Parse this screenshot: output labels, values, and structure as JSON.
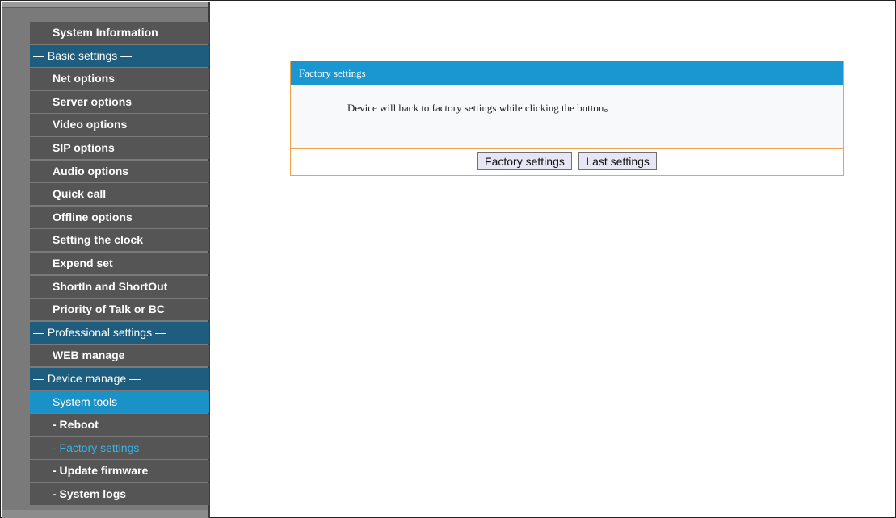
{
  "sidebar": {
    "items": [
      {
        "label": "System Information",
        "kind": "item"
      },
      {
        "label": "— Basic settings —",
        "kind": "group"
      },
      {
        "label": "Net options",
        "kind": "item"
      },
      {
        "label": "Server options",
        "kind": "item"
      },
      {
        "label": "Video options",
        "kind": "item"
      },
      {
        "label": "SIP options",
        "kind": "item"
      },
      {
        "label": "Audio options",
        "kind": "item"
      },
      {
        "label": "Quick call",
        "kind": "item"
      },
      {
        "label": "Offline options",
        "kind": "item"
      },
      {
        "label": "Setting the clock",
        "kind": "item"
      },
      {
        "label": "Expend set",
        "kind": "item"
      },
      {
        "label": "ShortIn and ShortOut",
        "kind": "item"
      },
      {
        "label": "Priority of Talk or BC",
        "kind": "item"
      },
      {
        "label": "— Professional settings —",
        "kind": "group"
      },
      {
        "label": "WEB manage",
        "kind": "item"
      },
      {
        "label": "— Device manage —",
        "kind": "group"
      },
      {
        "label": "System tools",
        "kind": "active-tool"
      },
      {
        "label": "- Reboot",
        "kind": "sub"
      },
      {
        "label": "- Factory settings",
        "kind": "sub-active"
      },
      {
        "label": "- Update firmware",
        "kind": "sub"
      },
      {
        "label": "- System logs",
        "kind": "sub"
      }
    ]
  },
  "panel": {
    "title": "Factory settings",
    "message": "Device will back to factory settings while clicking the button。",
    "buttons": {
      "factory": "Factory settings",
      "last": "Last settings"
    }
  },
  "colors": {
    "sidebar_bg": "#7a7a7a",
    "menu_item_bg": "#555555",
    "group_bg": "#1f5d7e",
    "active_tool_bg": "#1a92c8",
    "active_sub_text": "#38b4e8",
    "panel_header_bg": "#1a96d0",
    "panel_border": "#f0a24a"
  }
}
